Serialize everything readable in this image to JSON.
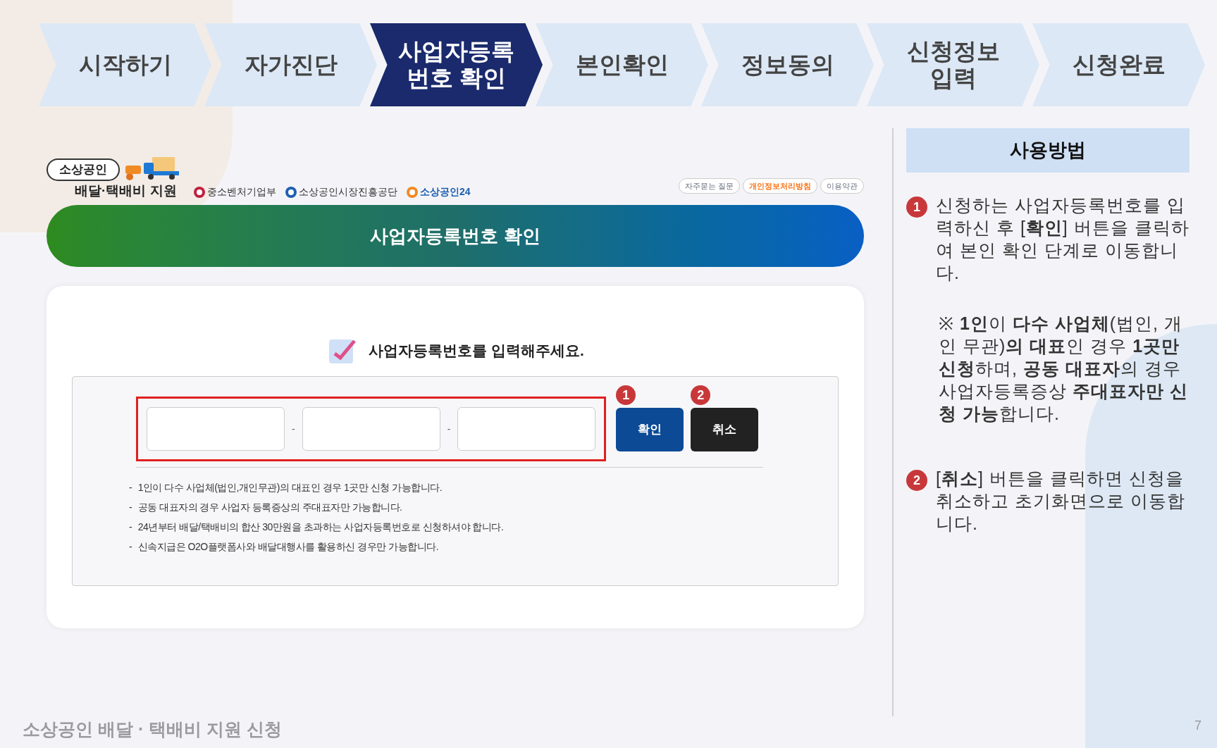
{
  "steps": [
    {
      "label": "시작하기",
      "selected": false
    },
    {
      "label": "자가진단",
      "selected": false
    },
    {
      "label": "사업자등록\n번호 확인",
      "selected": true
    },
    {
      "label": "본인확인",
      "selected": false
    },
    {
      "label": "정보동의",
      "selected": false
    },
    {
      "label": "신청정보\n입력",
      "selected": false
    },
    {
      "label": "신청완료",
      "selected": false
    }
  ],
  "brand": {
    "badge": "소상공인",
    "title": "배달·택배비 지원",
    "agencies": [
      "중소벤처기업부",
      "소상공인시장진흥공단",
      "소상공인24"
    ]
  },
  "top_links": [
    {
      "label": "자주묻는 질문",
      "highlighted": false
    },
    {
      "label": "개인정보처리방침",
      "highlighted": true
    },
    {
      "label": "이용약관",
      "highlighted": false
    }
  ],
  "banner": "사업자등록번호 확인",
  "form": {
    "prompt": "사업자등록번호를 입력해주세요.",
    "separators": [
      "-",
      "-"
    ],
    "buttons": [
      {
        "label": "확인",
        "marker": "1",
        "kind": "primary"
      },
      {
        "label": "취소",
        "marker": "2",
        "kind": "dark"
      }
    ],
    "notes": [
      "1인이 다수 사업체(법인,개인무관)의 대표인 경우 1곳만 신청 가능합니다.",
      "공동 대표자의 경우 사업자 등록증상의 주대표자만 가능합니다.",
      "24년부터 배달/택배비의 합산 30만원을 초과하는 사업자등록번호로 신청하셔야 합니다.",
      "신속지급은 O2O플랫폼사와 배달대행사를 활용하신 경우만 가능합니다."
    ],
    "note_bullet": "-"
  },
  "guide": {
    "title": "사용방법",
    "items": [
      {
        "marker": "1",
        "paragraphs": [
          "신청하는 사업자등록번호를 입력하신 후 [**확인**] 버튼을 클릭하여 본인 확인 단계로 이동합니다.",
          "※ **1인**이 **다수 사업체**(법인, 개인 무관)**의 대표**인 경우 **1곳만 신청**하며, **공동 대표자**의 경우 사업자등록증상 **주대표자만 신청 가능**합니다."
        ]
      },
      {
        "marker": "2",
        "paragraphs": [
          "[**취소**] 버튼을 클릭하면 신청을 취소하고 초기화면으로 이동합니다."
        ]
      }
    ]
  },
  "footer": "소상공인 배달 · 택배비 지원 신청",
  "page_number": "7"
}
